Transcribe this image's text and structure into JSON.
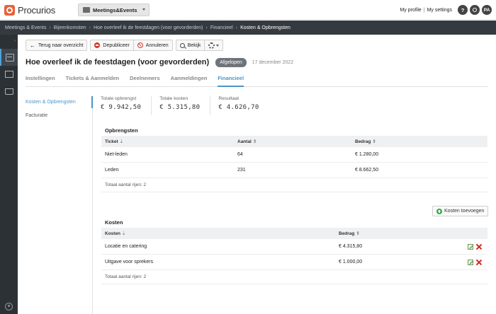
{
  "app": {
    "brand": "Procurios",
    "module": "Meetings&Events"
  },
  "user": {
    "profile_label": "My profile",
    "separator": "|",
    "settings_label": "My settings",
    "help_label": "?",
    "initials": "PA"
  },
  "breadcrumb": [
    "Meetings & Events",
    "Bijeenkomsten",
    "Hoe overleef ik de feestdagen (voor gevorderden)",
    "Financieel",
    "Kosten & Opbrengsten"
  ],
  "breadcrumb_sep": "›",
  "toolbar": {
    "back_label": "Terug naar overzicht",
    "unpublish_label": "Depubliceer",
    "cancel_label": "Annuleren",
    "view_label": "Bekijk"
  },
  "page": {
    "title": "Hoe overleef ik de feestdagen (voor gevorderden)",
    "status": "Afgelopen",
    "date": "17 december 2022"
  },
  "tabs": [
    {
      "label": "Instellingen"
    },
    {
      "label": "Tickets & Aanmelden"
    },
    {
      "label": "Deelnemers"
    },
    {
      "label": "Aanmeldingen"
    },
    {
      "label": "Financieel"
    }
  ],
  "subnav": [
    {
      "label": "Kosten & Opbrengsten"
    },
    {
      "label": "Facturatie"
    }
  ],
  "summary": [
    {
      "label": "Totale opbrengst",
      "value": "€ 9.942,50"
    },
    {
      "label": "Totale kosten",
      "value": "€ 5.315,80"
    },
    {
      "label": "Resultaat",
      "value": "€ 4.626,70"
    }
  ],
  "revenue": {
    "title": "Opbrengsten",
    "columns": [
      "Ticket",
      "Aantal",
      "Bedrag"
    ],
    "sort_desc": "⇣",
    "sort_both": "⇕",
    "rows": [
      {
        "ticket": "Niet-leden",
        "aantal": "64",
        "bedrag": "€ 1.280,00"
      },
      {
        "ticket": "Leden",
        "aantal": "231",
        "bedrag": "€ 8.662,50"
      }
    ],
    "total": "Totaal aantal rijen: 2"
  },
  "costs": {
    "add_label": "Kosten toevoegen",
    "title": "Kosten",
    "columns": [
      "Kosten",
      "Bedrag"
    ],
    "rows": [
      {
        "kosten": "Locatie en catering",
        "bedrag": "€ 4.315,80"
      },
      {
        "kosten": "Uitgave voor sprekers",
        "bedrag": "€ 1.000,00"
      }
    ],
    "total": "Totaal aantal rijen: 2"
  },
  "colors": {
    "accent": "#4a94c8",
    "brand": "#e8623a",
    "danger": "#d22b23",
    "success": "#3aa54a"
  }
}
